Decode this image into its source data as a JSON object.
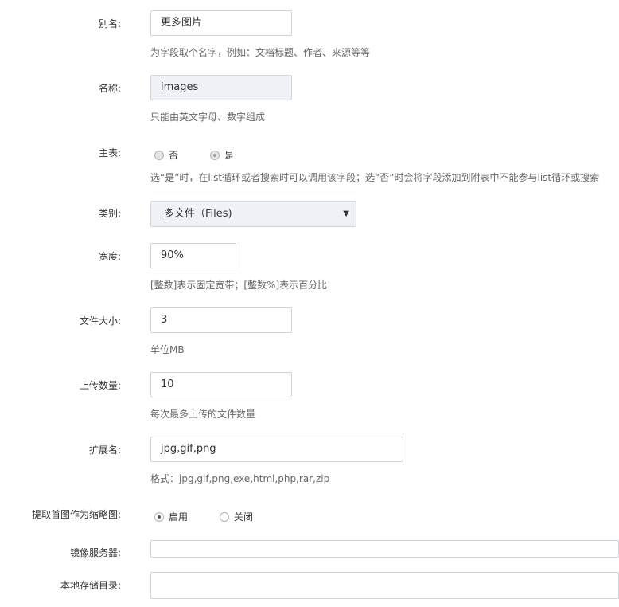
{
  "fields": {
    "alias": {
      "label": "别名:",
      "value": "更多图片",
      "help": "为字段取个名字，例如：文档标题、作者、来源等等"
    },
    "name": {
      "label": "名称:",
      "value": "images",
      "help": "只能由英文字母、数字组成"
    },
    "main_table": {
      "label": "主表:",
      "options": [
        "否",
        "是"
      ],
      "selected": "是",
      "help": "选“是”时，在list循环或者搜索时可以调用该字段；选“否”时会将字段添加到附表中不能参与list循环或搜索"
    },
    "category": {
      "label": "类别:",
      "value": "多文件（Files)"
    },
    "width": {
      "label": "宽度:",
      "value": "90%",
      "help": "[整数]表示固定宽带；[整数%]表示百分比"
    },
    "file_size": {
      "label": "文件大小:",
      "value": "3",
      "help": "单位MB"
    },
    "upload_count": {
      "label": "上传数量:",
      "value": "10",
      "help": "每次最多上传的文件数量"
    },
    "extensions": {
      "label": "扩展名:",
      "value": "jpg,gif,png",
      "help": "格式：jpg,gif,png,exe,html,php,rar,zip"
    },
    "thumbnail": {
      "label": "提取首图作为缩略图:",
      "options": [
        "启用",
        "关闭"
      ],
      "selected": "启用"
    },
    "mirror_server": {
      "label": "镜像服务器:",
      "value": ""
    },
    "local_dir": {
      "label": "本地存储目录:",
      "value": ""
    }
  }
}
